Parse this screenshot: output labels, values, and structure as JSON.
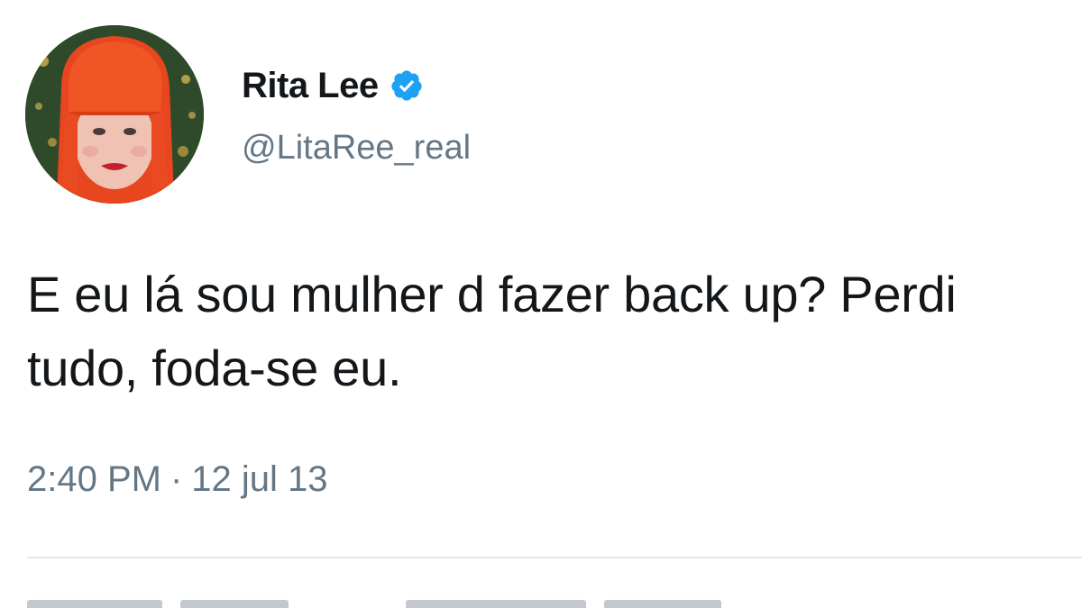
{
  "user": {
    "display_name": "Rita Lee",
    "handle": "@LitaRee_real",
    "verified": true,
    "avatar_icon": "profile-photo"
  },
  "tweet": {
    "text": "E eu lá sou mulher d fazer back up? Perdi tudo, foda-se eu.",
    "time": "2:40 PM",
    "separator": "·",
    "date": "12 jul 13"
  },
  "colors": {
    "verified_blue": "#1da1f2",
    "secondary_text": "#657786",
    "primary_text": "#14171a",
    "divider": "#e1e8ed"
  }
}
